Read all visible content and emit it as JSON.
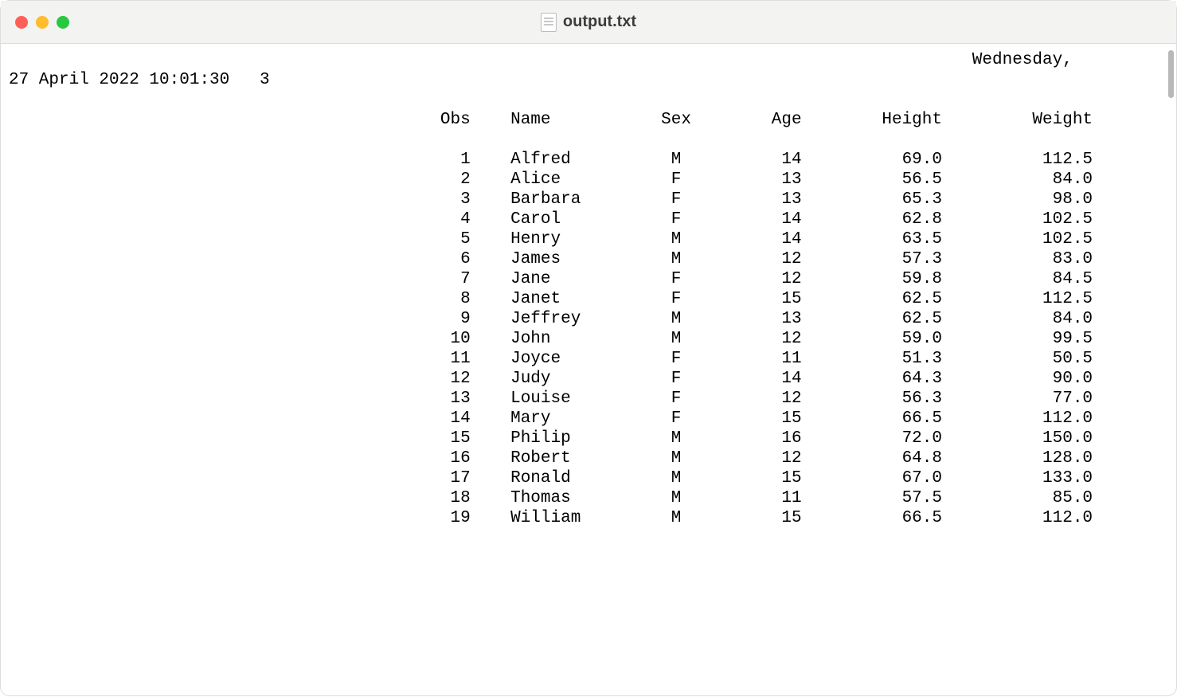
{
  "window": {
    "title": "output.txt"
  },
  "header": {
    "day": "Wednesday,",
    "date_line": "27 April 2022 10:01:30   3"
  },
  "table": {
    "columns": [
      "Obs",
      "Name",
      "Sex",
      "Age",
      "Height",
      "Weight"
    ],
    "rows": [
      {
        "obs": 1,
        "name": "Alfred",
        "sex": "M",
        "age": 14,
        "height": "69.0",
        "weight": "112.5"
      },
      {
        "obs": 2,
        "name": "Alice",
        "sex": "F",
        "age": 13,
        "height": "56.5",
        "weight": "84.0"
      },
      {
        "obs": 3,
        "name": "Barbara",
        "sex": "F",
        "age": 13,
        "height": "65.3",
        "weight": "98.0"
      },
      {
        "obs": 4,
        "name": "Carol",
        "sex": "F",
        "age": 14,
        "height": "62.8",
        "weight": "102.5"
      },
      {
        "obs": 5,
        "name": "Henry",
        "sex": "M",
        "age": 14,
        "height": "63.5",
        "weight": "102.5"
      },
      {
        "obs": 6,
        "name": "James",
        "sex": "M",
        "age": 12,
        "height": "57.3",
        "weight": "83.0"
      },
      {
        "obs": 7,
        "name": "Jane",
        "sex": "F",
        "age": 12,
        "height": "59.8",
        "weight": "84.5"
      },
      {
        "obs": 8,
        "name": "Janet",
        "sex": "F",
        "age": 15,
        "height": "62.5",
        "weight": "112.5"
      },
      {
        "obs": 9,
        "name": "Jeffrey",
        "sex": "M",
        "age": 13,
        "height": "62.5",
        "weight": "84.0"
      },
      {
        "obs": 10,
        "name": "John",
        "sex": "M",
        "age": 12,
        "height": "59.0",
        "weight": "99.5"
      },
      {
        "obs": 11,
        "name": "Joyce",
        "sex": "F",
        "age": 11,
        "height": "51.3",
        "weight": "50.5"
      },
      {
        "obs": 12,
        "name": "Judy",
        "sex": "F",
        "age": 14,
        "height": "64.3",
        "weight": "90.0"
      },
      {
        "obs": 13,
        "name": "Louise",
        "sex": "F",
        "age": 12,
        "height": "56.3",
        "weight": "77.0"
      },
      {
        "obs": 14,
        "name": "Mary",
        "sex": "F",
        "age": 15,
        "height": "66.5",
        "weight": "112.0"
      },
      {
        "obs": 15,
        "name": "Philip",
        "sex": "M",
        "age": 16,
        "height": "72.0",
        "weight": "150.0"
      },
      {
        "obs": 16,
        "name": "Robert",
        "sex": "M",
        "age": 12,
        "height": "64.8",
        "weight": "128.0"
      },
      {
        "obs": 17,
        "name": "Ronald",
        "sex": "M",
        "age": 15,
        "height": "67.0",
        "weight": "133.0"
      },
      {
        "obs": 18,
        "name": "Thomas",
        "sex": "M",
        "age": 11,
        "height": "57.5",
        "weight": "85.0"
      },
      {
        "obs": 19,
        "name": "William",
        "sex": "M",
        "age": 15,
        "height": "66.5",
        "weight": "112.0"
      }
    ]
  },
  "layout": {
    "day_leading_spaces": 96,
    "indent_spaces": 42,
    "col_widths": {
      "obs": 4,
      "name": 11,
      "sex": 3,
      "age": 7,
      "height": 10,
      "weight": 11
    },
    "gap": "    "
  }
}
